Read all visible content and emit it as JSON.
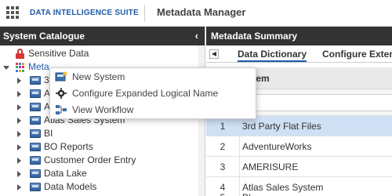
{
  "header": {
    "brand": "DATA INTELLIGENCE SUITE",
    "app_title": "Metadata Manager"
  },
  "left_panel": {
    "title": "System Catalogue",
    "collapse_glyph": "‹",
    "tree": {
      "sensitive": "Sensitive Data",
      "metadata_root": "Meta",
      "partial_labels": [
        "3r",
        "A",
        "A"
      ],
      "items": [
        "Atlas Sales System",
        "BI",
        "BO Reports",
        "Customer Order Entry",
        "Data Lake",
        "Data Models"
      ]
    }
  },
  "context_menu": {
    "items": [
      {
        "label": "New System",
        "icon": "new-system-icon"
      },
      {
        "label": "Configure Expanded Logical Name",
        "icon": "gear-icon"
      },
      {
        "label": "View Workflow",
        "icon": "workflow-icon"
      }
    ]
  },
  "right_panel": {
    "title": "Metadata Summary",
    "tabs": [
      "Data Dictionary",
      "Configure Exten"
    ],
    "table": {
      "column_header": "ystem",
      "rows": [
        {
          "num": "1",
          "name": "3rd Party Flat Files",
          "selected": true
        },
        {
          "num": "2",
          "name": "AdventureWorks"
        },
        {
          "num": "3",
          "name": "AMERISURE"
        },
        {
          "num": "4",
          "name": "Atlas Sales System"
        },
        {
          "num": "5",
          "name": "Bl"
        }
      ]
    }
  },
  "colors": {
    "brand_blue": "#1d5aa8",
    "header_dark": "#333333",
    "selected_row": "#cfe0f4"
  }
}
